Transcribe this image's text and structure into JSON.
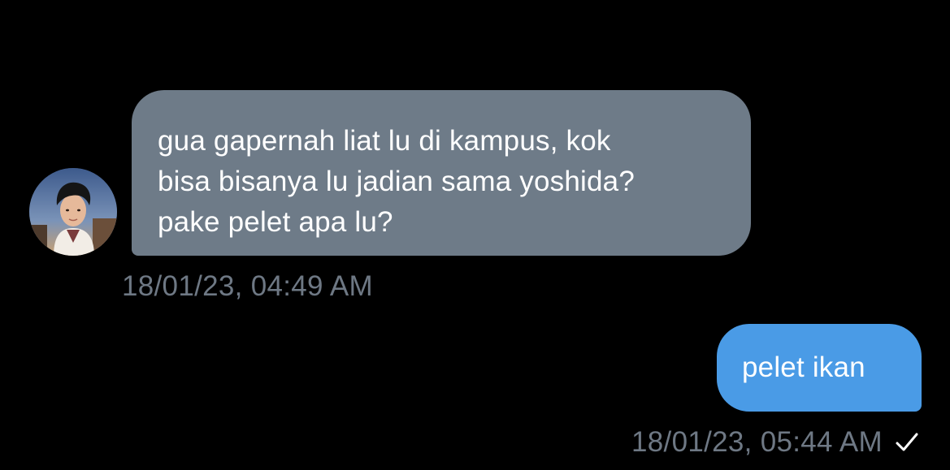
{
  "conversation": {
    "incoming": {
      "avatar_icon": "user-avatar-photo",
      "lines": [
        "gua gapernah liat lu di kampus, kok",
        "bisa bisanya lu jadian sama yoshida?",
        "pake pelet apa lu?"
      ],
      "timestamp": "18/01/23, 04:49 AM"
    },
    "outgoing": {
      "text": "pelet ikan",
      "timestamp": "18/01/23, 05:44 AM",
      "status_icon": "check-icon"
    }
  },
  "colors": {
    "background": "#000000",
    "incoming_bubble": "#6e7b88",
    "outgoing_bubble": "#4a9be6",
    "timestamp": "#6e7884",
    "text": "#ffffff"
  }
}
